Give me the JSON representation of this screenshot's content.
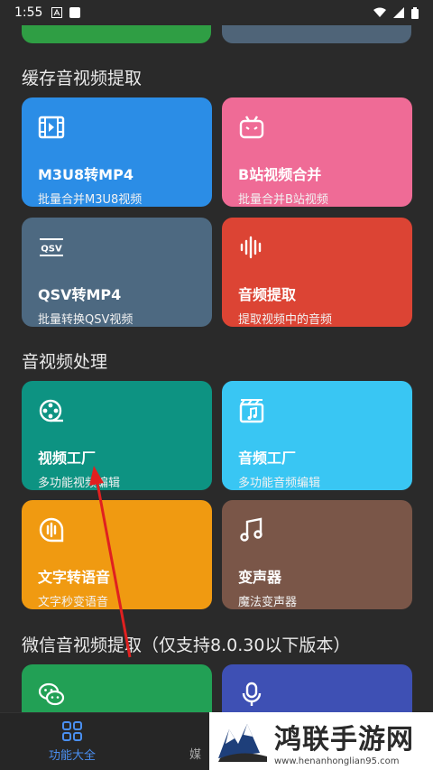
{
  "status": {
    "time": "1:55"
  },
  "sections": [
    {
      "title": "缓存音视频提取"
    },
    {
      "title": "音视频处理"
    },
    {
      "title": "微信音视频提取（仅支持8.0.30以下版本）"
    }
  ],
  "cards": {
    "m3u8": {
      "title": "M3U8转MP4",
      "sub": "批量合并M3U8视频"
    },
    "bili": {
      "title": "B站视频合并",
      "sub": "批量合并B站视频"
    },
    "qsv": {
      "title": "QSV转MP4",
      "sub": "批量转换QSV视频"
    },
    "audio_extract": {
      "title": "音频提取",
      "sub": "提取视频中的音频"
    },
    "video_factory": {
      "title": "视频工厂",
      "sub": "多功能视频编辑"
    },
    "audio_factory": {
      "title": "音频工厂",
      "sub": "多功能音频编辑"
    },
    "tts": {
      "title": "文字转语音",
      "sub": "文字秒变语音"
    },
    "voice_changer": {
      "title": "变声器",
      "sub": "魔法变声器"
    }
  },
  "nav": {
    "home": "功能大全",
    "media": "媒"
  },
  "watermark": {
    "title": "鸿联手游网",
    "url": "www.henanhonglian95.com"
  }
}
